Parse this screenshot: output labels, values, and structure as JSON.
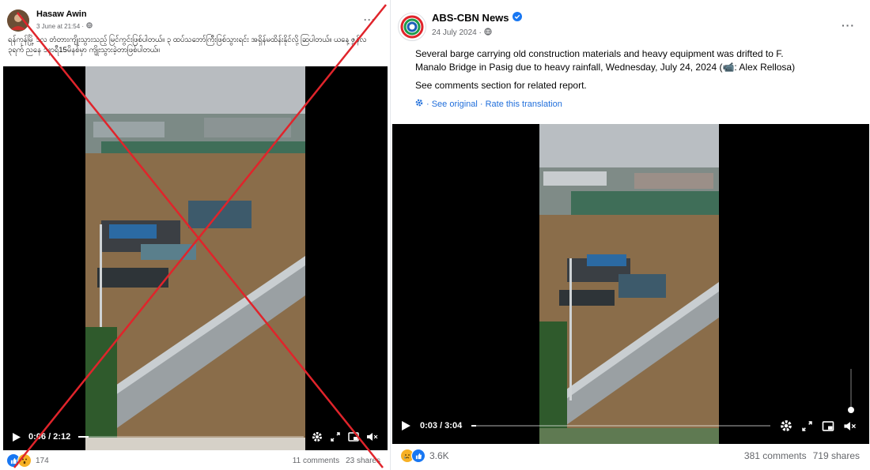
{
  "left_post": {
    "author": "Hasaw Awin",
    "timestamp": "3 June at 21:54 ·",
    "text": "ရန်ကုန်မြို့ ဒလ တံတားကျိုးသွားသည့် မြင်ကွင်းဖြစ်ပါတယ်။ ၃ ထပ်သဘော်ကြီးဖြစ်သွားရင်း အရှိန်မထိန်းနိုင်လို့ ဆြပါတယ်။ ယနေ့ ဇွန်လ ၃ရက် ညနေ ၁နာရီ15မိနစ်မှာ ကျိုးသွားခဲ့တာဖြစ်ပါတယ်။",
    "more_icon": "ellipsis-icon",
    "video": {
      "time": "0:06 / 2:12",
      "progress": 0.045
    },
    "reactions": [
      "like",
      "wow"
    ],
    "reaction_count": "174",
    "comments": "11 comments",
    "shares": "23 shares",
    "cross_color": "#e0242b"
  },
  "right_post": {
    "author": "ABS-CBN News",
    "timestamp": "24 July 2024 ·",
    "verified_icon": "verified-badge-icon",
    "more_icon": "ellipsis-icon",
    "text_line1": "Several barge carrying old construction materials and heavy equipment was drifted to F.",
    "text_line2": "Manalo Bridge in Pasig due to heavy rainfall, Wednesday, July 24, 2024 (📹: Alex Rellosa)",
    "text_line3": "See comments section for related report.",
    "translate_links": "· See original · Rate this translation",
    "video": {
      "time": "0:03 / 3:04",
      "progress": 0.016
    },
    "reactions": [
      "sad",
      "like"
    ],
    "reaction_count": "3.6K",
    "comments": "381 comments",
    "shares": "719 shares"
  },
  "colors": {
    "fb_blue": "#1877f2",
    "secondary_text": "#65676b",
    "floodwater": "#8a6d4a"
  }
}
